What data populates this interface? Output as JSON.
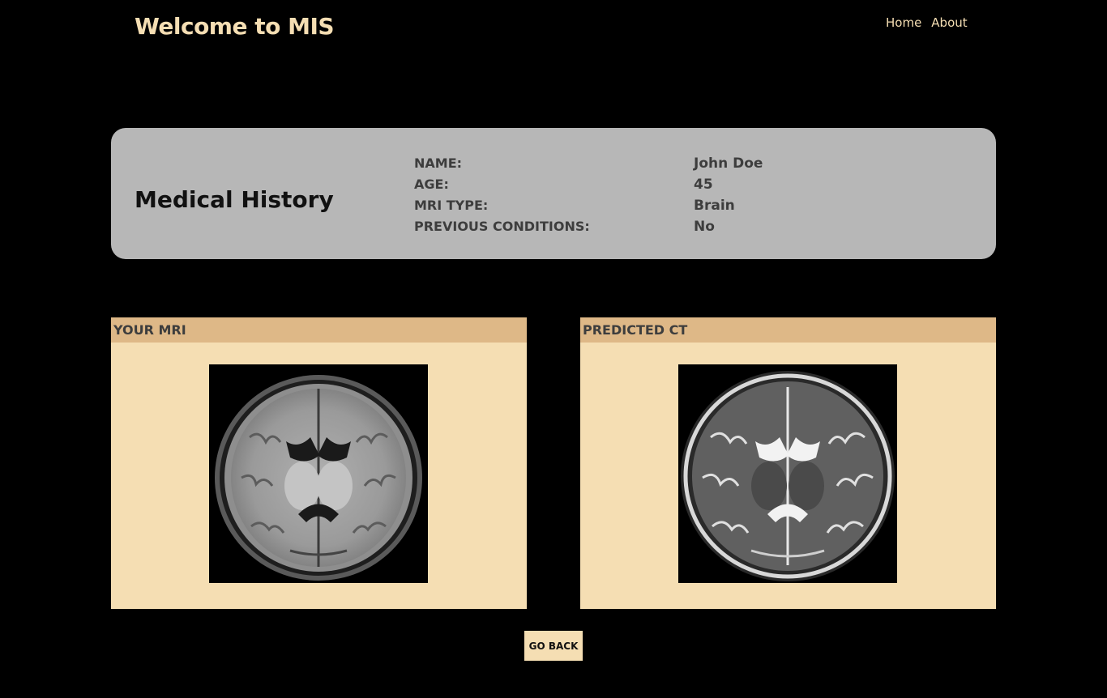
{
  "header": {
    "brand": "Welcome to MIS",
    "nav": [
      "Home",
      "About"
    ]
  },
  "history": {
    "title": "Medical History",
    "labels": [
      "NAME:",
      "AGE:",
      "MRI TYPE:",
      "PREVIOUS CONDITIONS:"
    ],
    "values": [
      "John Doe",
      "45",
      "Brain",
      "No"
    ]
  },
  "panels": {
    "mri": {
      "title": "YOUR MRI"
    },
    "ct": {
      "title": "PREDICTED CT"
    }
  },
  "actions": {
    "back_label": "GO BACK"
  },
  "colors": {
    "background": "#000000",
    "accent": "#f5deb3",
    "panel_header": "#deb887",
    "card": "#b7b7b7"
  }
}
